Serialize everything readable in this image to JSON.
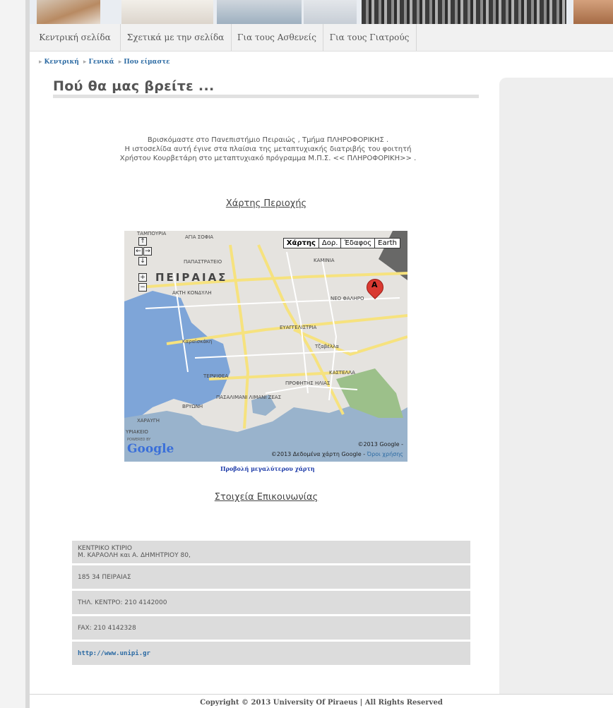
{
  "nav": {
    "items": [
      {
        "label": "Κεντρική σελίδα"
      },
      {
        "label": "Σχετικά με την σελίδα"
      },
      {
        "label": "Για τους Ασθενείς"
      },
      {
        "label": "Για τους Γιατρούς"
      }
    ]
  },
  "breadcrumb": {
    "items": [
      "Κεντρική",
      "Γενικά",
      "Που είμαστε"
    ]
  },
  "page": {
    "title": "Πού θα μας βρείτε ...",
    "intro_lines": [
      "Βρισκόμαστε στο Πανεπιστήμιο Πειραιώς , Τμήμα ΠΛΗΡΟΦΟΡΙΚΗΣ .",
      "Η ιστοσελίδα αυτή έγινε στα πλαίσια της μεταπτυχιακής διατριβής του φοιτητή",
      "Χρήστου Κουρβετάρη στο μεταπτυχιακό πρόγραμμα Μ.Π.Σ. << ΠΛΗΡΟΦΟΡΙΚΗ>> ."
    ],
    "map_heading": "Χάρτης Περιοχής",
    "contact_heading": "Στοιχεία Επικοινωνίας",
    "map_link": "Προβολή μεγαλύτερου χάρτη"
  },
  "map": {
    "tabs": [
      "Χάρτης",
      "Δορ.",
      "Έδαφος",
      "Earth"
    ],
    "city_label": "ΠΕΙΡΑΙΑΣ",
    "marker_letter": "A",
    "logo": "Google",
    "powered_by": "POWERED BY",
    "copyright_1": "©2013 Google -",
    "copyright_2": "©2013 Δεδομένα χάρτη Google -",
    "terms": "Όροι χρήσης",
    "labels": [
      "ΤΑΜΠΟΥΡΙΑ",
      "ΑΓΙΑ ΣΟΦΙΑ",
      "ΠΑΠΑΣΤΡΑΤΕΙΟ",
      "ΚΑΜΙΝΙΑ",
      "ΑΚΤΗ ΚΟΝΔΥΛΗ",
      "ΝΕΟ ΦΑΛΗΡΟ",
      "ΕΥΑΓΓΕΛΙΣΤΡΙΑ",
      "Καραϊσκάκη",
      "Τζαβέλλα",
      "ΚΑΣΤΕΛΛΑ",
      "ΤΕΡΨΙΘΕΑ",
      "ΠΡΟΦΗΤΗΣ ΗΛΙΑΣ",
      "ΠΑΣΑΛΙΜΑΝΙ ΛΙΜΑΝΙ ΖΕΑΣ",
      "ΒΡΥΩΝΗ",
      "ΧΑΡΑΥΓΗ",
      "ΥΡΙΑΚΕΙΟ"
    ]
  },
  "contact": {
    "rows": [
      {
        "line1": "ΚΕΝΤΡΙΚΟ ΚΤΙΡΙΟ",
        "line2": "Μ. ΚΑΡΑΟΛΗ και Α. ΔΗΜΗΤΡΙΟΥ 80,"
      },
      {
        "line1": "185 34 ΠΕΙΡΑΙΑΣ"
      },
      {
        "line1": "ΤΗΛ. ΚΕΝΤΡΟ: 210 4142000"
      },
      {
        "line1": "FAX: 210 4142328"
      },
      {
        "link": "http://www.unipi.gr"
      }
    ]
  },
  "footer": {
    "text": "Copyright © 2013 University Of Piraeus | All Rights Reserved"
  },
  "colors": {
    "link": "#2b6aa3",
    "nav_bg": "#f1f1f1",
    "row_bg": "#dcdcdc",
    "marker": "#d93a32"
  }
}
